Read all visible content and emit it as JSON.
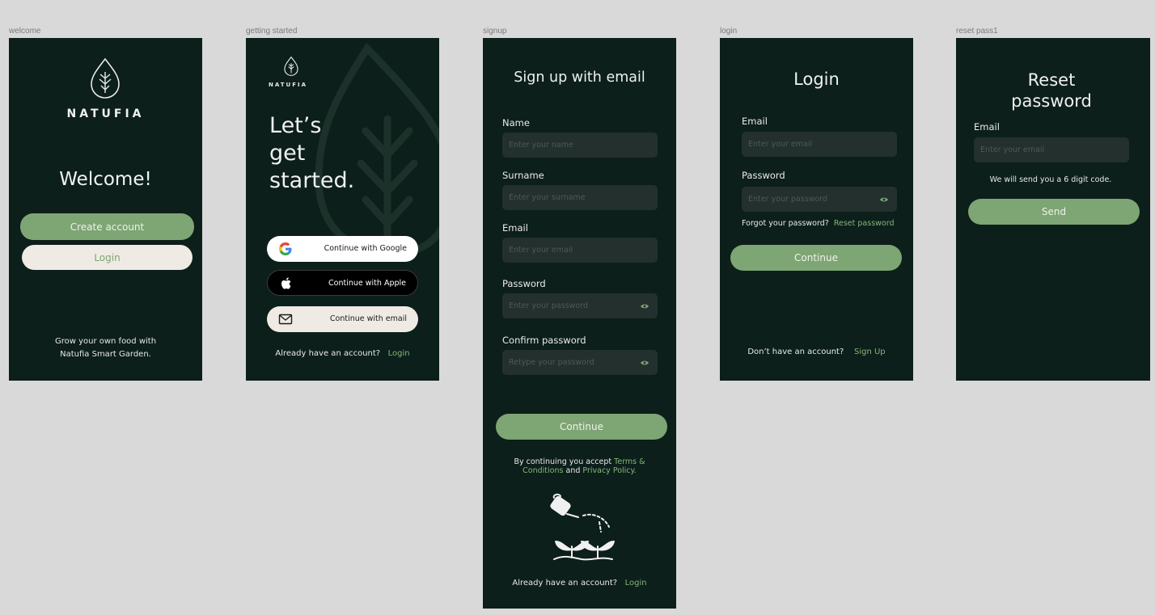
{
  "frames": {
    "welcome": {
      "label": "welcome",
      "brand": "NATUFIA",
      "heading": "Welcome!",
      "create_account": "Create account",
      "login": "Login",
      "footer_line1": "Grow your own food with",
      "footer_line2": "Natufia Smart Garden."
    },
    "getting_started": {
      "label": "getting started",
      "brand": "NATUFIA",
      "heading_line1": "Let’s",
      "heading_line2": "get",
      "heading_line3": "started.",
      "google": "Continue with Google",
      "apple": "Continue with Apple",
      "email": "Continue with email",
      "have_account": "Already have an account?",
      "login": "Login"
    },
    "signup": {
      "label": "signup",
      "title": "Sign up with email",
      "name_label": "Name",
      "name_placeholder": "Enter your name",
      "surname_label": "Surname",
      "surname_placeholder": "Enter your surname",
      "email_label": "Email",
      "email_placeholder": "Enter your email",
      "password_label": "Password",
      "password_placeholder": "Enter your password",
      "confirm_label": "Confirm password",
      "confirm_placeholder": "Retype your password",
      "continue": "Continue",
      "terms_pre": "By continuing you accept",
      "terms_link1": "Terms &",
      "terms_link2": "Conditions",
      "terms_and": "and",
      "privacy_link": "Privacy Policy.",
      "have_account": "Already have an account?",
      "login": "Login"
    },
    "login": {
      "label": "login",
      "title": "Login",
      "email_label": "Email",
      "email_placeholder": "Enter your email",
      "password_label": "Password",
      "password_placeholder": "Enter your password",
      "forgot": "Forgot your password?",
      "reset": "Reset password",
      "continue": "Continue",
      "no_account": "Don’t have an account?",
      "signup": "Sign Up"
    },
    "reset": {
      "label": "reset pass1",
      "title_line1": "Reset",
      "title_line2": "password",
      "email_label": "Email",
      "email_placeholder": "Enter your email",
      "note": "We will send you a 6 digit code.",
      "send": "Send"
    }
  },
  "colors": {
    "background": "#d9d9d9",
    "frame": "#0c1f1a",
    "accent_green": "#7ea574",
    "link_green": "#86b57b",
    "light_button": "#efebe4",
    "input": "#23302d"
  }
}
